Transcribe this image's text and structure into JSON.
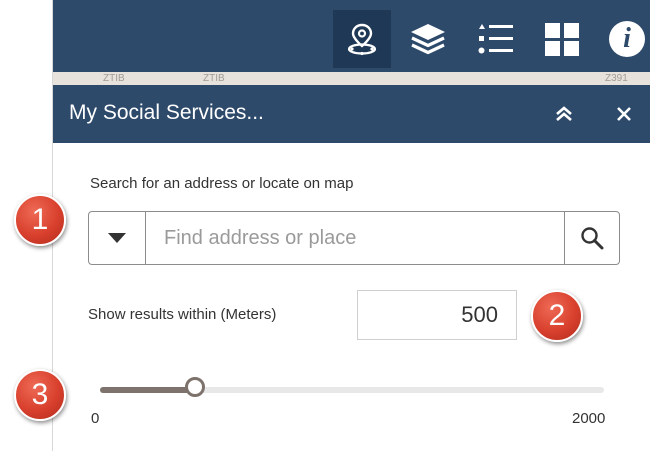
{
  "map": {
    "labels": [
      "ZTIB",
      "ZTIB",
      "Z391"
    ]
  },
  "toolbar": {
    "tools": [
      {
        "icon": "location-search-icon",
        "active": true
      },
      {
        "icon": "layers-icon",
        "active": false
      },
      {
        "icon": "legend-list-icon",
        "active": false
      },
      {
        "icon": "basemap-gallery-icon",
        "active": false
      },
      {
        "icon": "info-icon",
        "active": false
      }
    ],
    "info_glyph": "i"
  },
  "panel": {
    "title": "My Social Services...",
    "collapse_glyph": "︽",
    "close_glyph": "✕"
  },
  "search": {
    "label": "Search for an address or locate on map",
    "placeholder": "Find address or place",
    "value": ""
  },
  "distance": {
    "label": "Show results within (Meters)",
    "value": "500"
  },
  "slider": {
    "min": "0",
    "max": "2000",
    "value": 500
  },
  "callouts": [
    "1",
    "2",
    "3"
  ],
  "colors": {
    "header": "#2e4a6b",
    "callout": "#d8402d",
    "slider": "#7d736c"
  }
}
